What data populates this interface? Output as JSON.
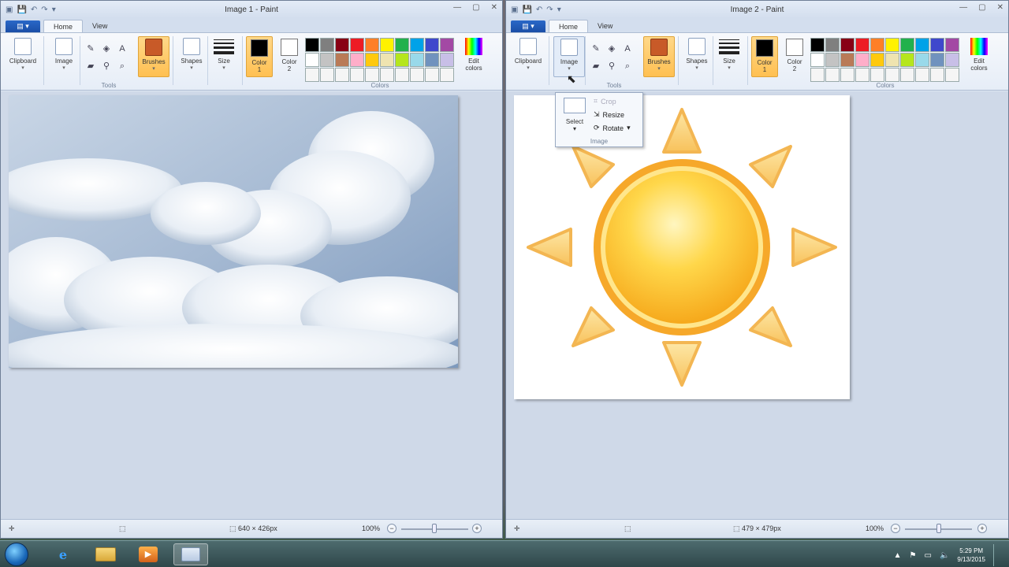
{
  "window1": {
    "title": "Image 1 - Paint",
    "tabs": [
      "Home",
      "View"
    ],
    "status_size": "640 × 426px",
    "zoom": "100%"
  },
  "window2": {
    "title": "Image 2 - Paint",
    "tabs": [
      "Home",
      "View"
    ],
    "status_size": "479 × 479px",
    "zoom": "100%"
  },
  "ribbon": {
    "clipboard": "Clipboard",
    "image": "Image",
    "tools_group": "Tools",
    "brushes": "Brushes",
    "shapes": "Shapes",
    "size": "Size",
    "color1_a": "Color",
    "color1_b": "1",
    "color2_a": "Color",
    "color2_b": "2",
    "colors_group": "Colors",
    "edit_a": "Edit",
    "edit_b": "colors"
  },
  "palette": [
    "#000000",
    "#7f7f7f",
    "#880015",
    "#ed1c24",
    "#ff7f27",
    "#fff200",
    "#22b14c",
    "#00a2e8",
    "#3f48cc",
    "#a349a4",
    "#ffffff",
    "#c3c3c3",
    "#b97a57",
    "#ffaec9",
    "#ffc90e",
    "#efe4b0",
    "#b5e61d",
    "#99d9ea",
    "#7092be",
    "#c8bfe7",
    "#f5f5f5",
    "#f5f5f5",
    "#f5f5f5",
    "#f5f5f5",
    "#f5f5f5",
    "#f5f5f5",
    "#f5f5f5",
    "#f5f5f5",
    "#f5f5f5",
    "#f5f5f5"
  ],
  "image_menu": {
    "select": "Select",
    "crop": "Crop",
    "resize": "Resize",
    "rotate": "Rotate",
    "group": "Image"
  },
  "taskbar": {
    "time": "5:29 PM",
    "date": "9/13/2015"
  }
}
